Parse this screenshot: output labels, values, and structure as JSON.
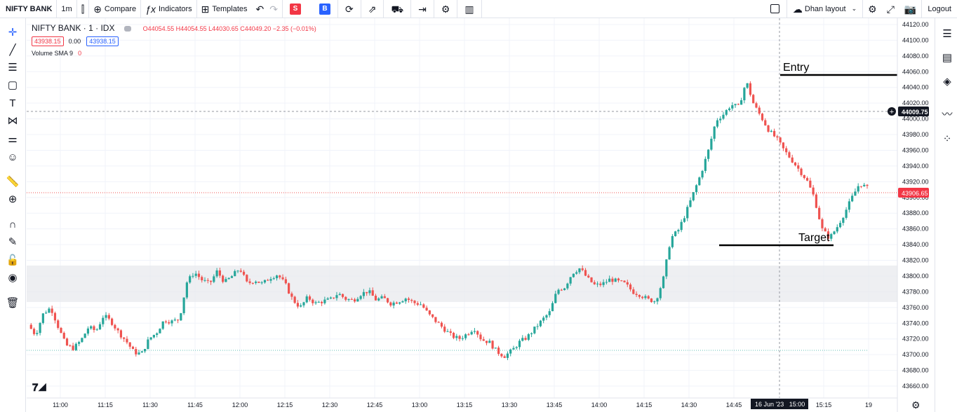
{
  "toolbar": {
    "symbol": "NIFTY BANK",
    "interval": "1m",
    "compare_label": "Compare",
    "indicators_label": "Indicators",
    "templates_label": "Templates",
    "sell_label": "S",
    "buy_label": "B",
    "layout_label": "Dhan layout",
    "logout_label": "Logout"
  },
  "legend": {
    "title": "NIFTY BANK · 1 · IDX",
    "ohlc": "O44054.55 H44054.55 L44030.65 C44049.20 −2.35 (−0.01%)",
    "sell_price": "43938.15",
    "spread": "0.00",
    "buy_price": "43938.15",
    "volume_label": "Volume SMA 9",
    "volume_value": "0"
  },
  "colors": {
    "up": "#26a69a",
    "down": "#ef5350",
    "sell": "#f23645",
    "buy": "#2962ff"
  },
  "price_axis": {
    "ticks": [
      "44120.00",
      "44100.00",
      "44080.00",
      "44060.00",
      "44040.00",
      "44020.00",
      "44000.00",
      "43980.00",
      "43960.00",
      "43940.00",
      "43920.00",
      "43900.00",
      "43880.00",
      "43860.00",
      "43840.00",
      "43820.00",
      "43800.00",
      "43780.00",
      "43760.00",
      "43740.00",
      "43720.00",
      "43700.00",
      "43680.00",
      "43660.00"
    ],
    "crosshair_label": "44009.75",
    "last_price_label": "43906.65"
  },
  "time_axis": {
    "ticks": [
      "11:00",
      "11:15",
      "11:30",
      "11:45",
      "12:00",
      "12:15",
      "12:30",
      "12:45",
      "13:00",
      "13:15",
      "13:30",
      "13:45",
      "14:00",
      "14:15",
      "14:30",
      "14:45",
      "15:15",
      "19"
    ],
    "crosshair_label": "16 Jun '23   15:00"
  },
  "annotations": {
    "entry": "Entry",
    "target": "Target"
  },
  "chart_data": {
    "type": "candlestick",
    "x_start": "10:55",
    "interval": "1m",
    "close_path": [
      43738,
      43725,
      43752,
      43760,
      43735,
      43712,
      43708,
      43718,
      43735,
      43730,
      43750,
      43742,
      43728,
      43717,
      43703,
      43701,
      43720,
      43728,
      43744,
      43742,
      43745,
      43792,
      43805,
      43795,
      43790,
      43806,
      43792,
      43800,
      43810,
      43790,
      43795,
      43790,
      43798,
      43802,
      43790,
      43770,
      43760,
      43773,
      43765,
      43768,
      43770,
      43778,
      43771,
      43769,
      43777,
      43781,
      43770,
      43772,
      43765,
      43768,
      43772,
      43766,
      43764,
      43751,
      43742,
      43733,
      43724,
      43720,
      43726,
      43734,
      43719,
      43716,
      43704,
      43698,
      43705,
      43716,
      43722,
      43733,
      43744,
      43754,
      43782,
      43786,
      43804,
      43810,
      43797,
      43788,
      43790,
      43796,
      43793,
      43790,
      43780,
      43776,
      43770,
      43768,
      43795,
      43848,
      43858,
      43880,
      43905,
      43930,
      43960,
      43998,
      44006,
      44018,
      44015,
      44048,
      44018,
      44002,
      43985,
      43975,
      43960,
      43948,
      43935,
      43922,
      43900,
      43860,
      43848,
      43862,
      43880,
      43900,
      43918,
      43912
    ]
  }
}
